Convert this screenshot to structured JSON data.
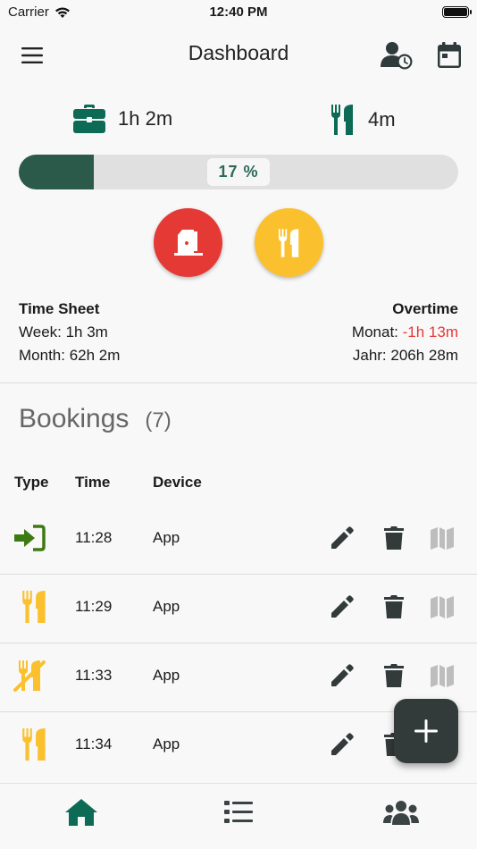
{
  "status_bar": {
    "carrier": "Carrier",
    "time": "12:40 PM"
  },
  "nav": {
    "title": "Dashboard"
  },
  "stats": {
    "work_time": "1h 2m",
    "break_time": "4m",
    "progress_percent": 17,
    "progress_label": "17 %"
  },
  "time_sheet": {
    "title": "Time Sheet",
    "week": "Week: 1h 3m",
    "month": "Month: 62h 2m"
  },
  "overtime": {
    "title": "Overtime",
    "monat_label": "Monat: ",
    "monat_value": "-1h 13m",
    "jahr": "Jahr: 206h 28m"
  },
  "bookings": {
    "title": "Bookings",
    "count": "(7)",
    "columns": {
      "type": "Type",
      "time": "Time",
      "device": "Device"
    },
    "rows": [
      {
        "type": "check-in",
        "time": "11:28",
        "device": "App"
      },
      {
        "type": "break-start",
        "time": "11:29",
        "device": "App"
      },
      {
        "type": "break-end",
        "time": "11:33",
        "device": "App"
      },
      {
        "type": "break-start",
        "time": "11:34",
        "device": "App"
      }
    ]
  },
  "colors": {
    "brand": "#0d6b55",
    "dark_green": "#2c5a4a",
    "red": "#e53935",
    "yellow": "#fbc02d",
    "checkin_green": "#3d7a12",
    "fab": "#333a3a"
  },
  "icons": {
    "menu": "menu-icon",
    "user_clock": "user-clock-icon",
    "calendar": "calendar-icon",
    "work": "briefcase-icon",
    "break": "utensils-icon",
    "edit": "pencil-icon",
    "delete": "trash-icon",
    "map": "map-icon",
    "tabs": [
      "home-icon",
      "list-icon",
      "users-icon"
    ]
  }
}
